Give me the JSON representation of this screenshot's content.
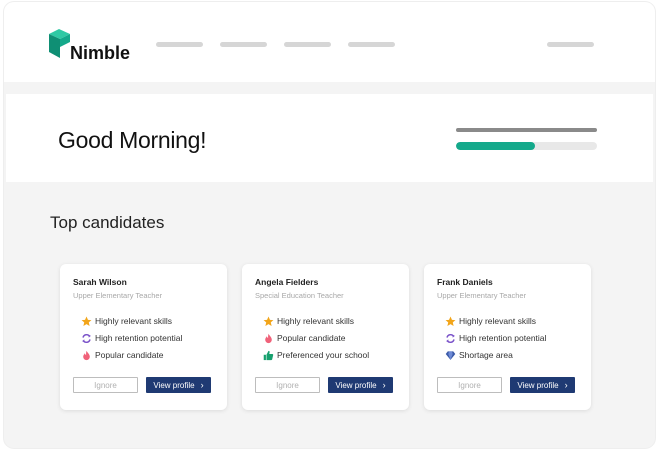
{
  "app": {
    "brand": "Nimble"
  },
  "greeting": {
    "title": "Good Morning!",
    "progress": 0.56
  },
  "section": {
    "title": "Top candidates"
  },
  "colors": {
    "accent": "#14a98b",
    "primary_button": "#1f3a73",
    "logo": "#14a98b"
  },
  "candidates": [
    {
      "name": "Sarah Wilson",
      "role": "Upper Elementary Teacher",
      "features": [
        {
          "icon": "star-icon",
          "label": "Highly relevant skills"
        },
        {
          "icon": "retention-cycle-icon",
          "label": "High retention potential"
        },
        {
          "icon": "flame-icon",
          "label": "Popular candidate"
        }
      ],
      "ignore_label": "Ignore",
      "view_label": "View profile"
    },
    {
      "name": "Angela Fielders",
      "role": "Special Education Teacher",
      "features": [
        {
          "icon": "star-icon",
          "label": "Highly relevant skills"
        },
        {
          "icon": "flame-icon",
          "label": "Popular candidate"
        },
        {
          "icon": "thumbs-up-icon",
          "label": "Preferenced your school"
        }
      ],
      "ignore_label": "Ignore",
      "view_label": "View profile"
    },
    {
      "name": "Frank Daniels",
      "role": "Upper Elementary Teacher",
      "features": [
        {
          "icon": "star-icon",
          "label": "Highly relevant skills"
        },
        {
          "icon": "retention-cycle-icon",
          "label": "High retention potential"
        },
        {
          "icon": "diamond-icon",
          "label": "Shortage area"
        }
      ],
      "ignore_label": "Ignore",
      "view_label": "View profile"
    }
  ]
}
